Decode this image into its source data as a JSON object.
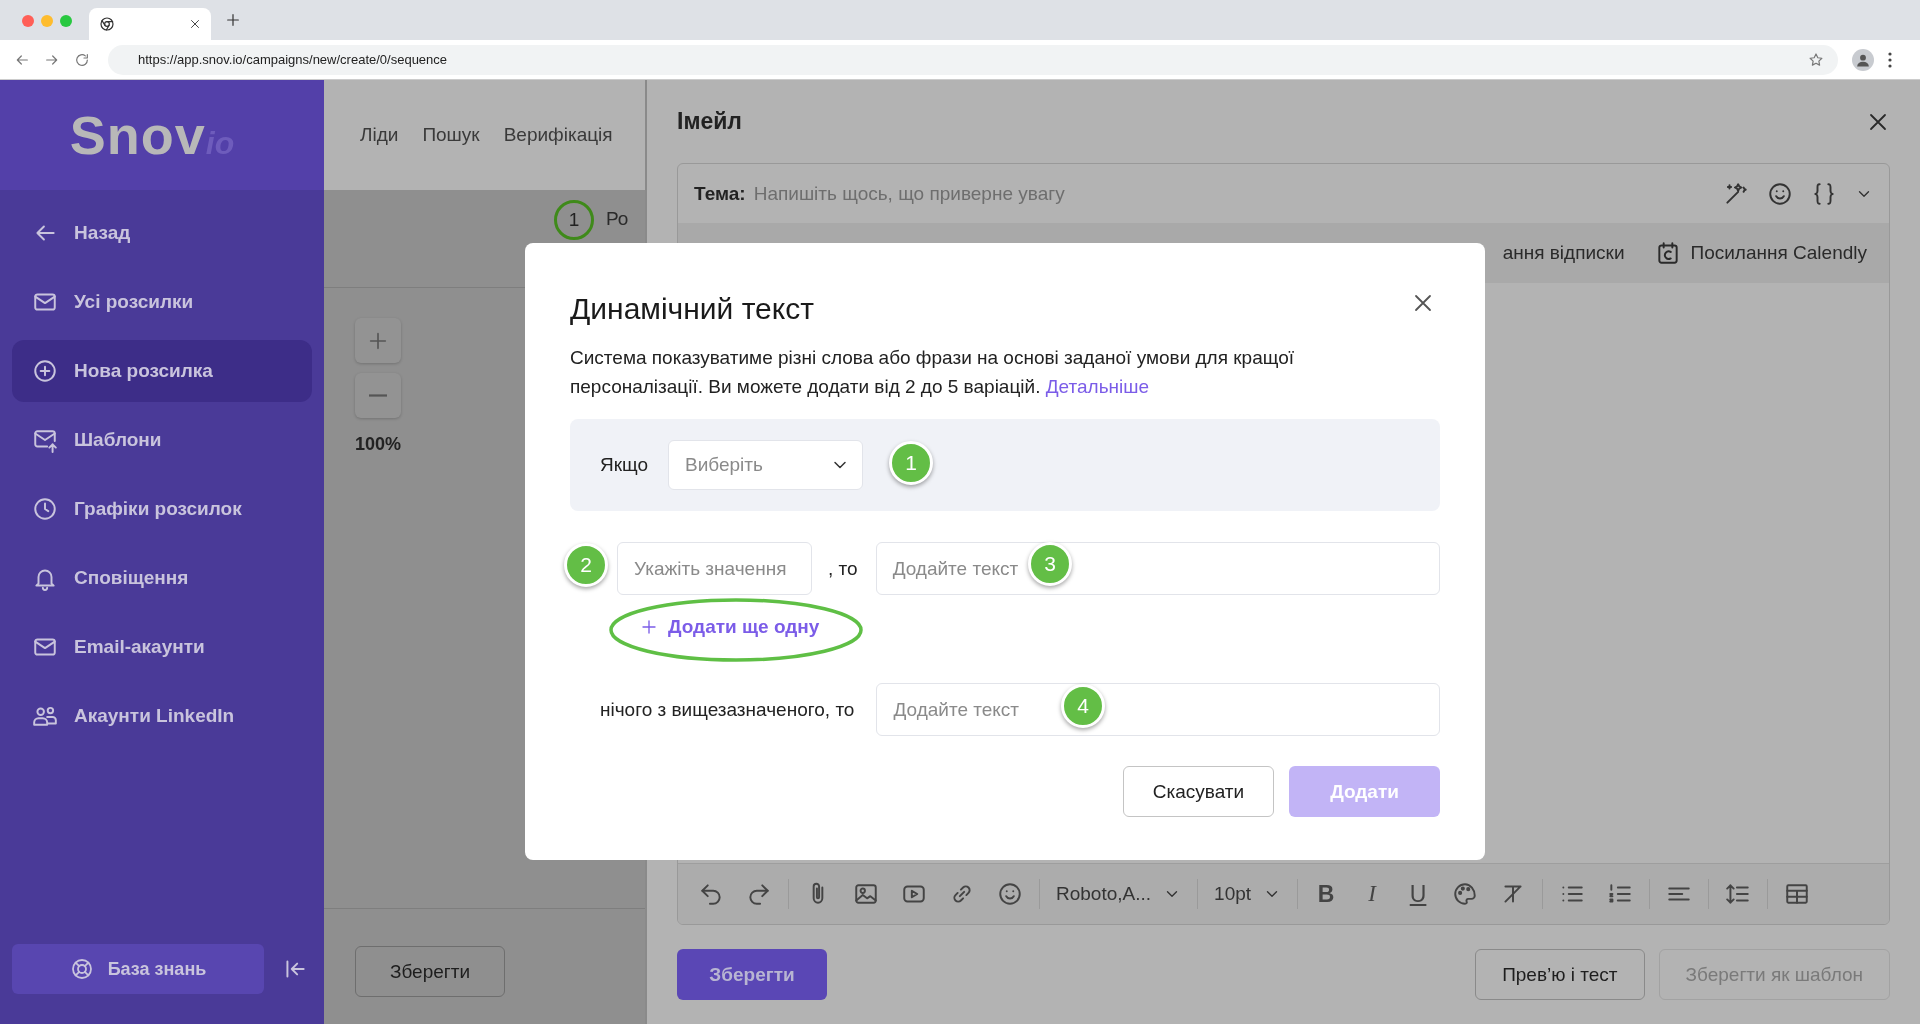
{
  "browser": {
    "url": "https://app.snov.io/campaigns/new/create/0/sequence"
  },
  "sidebar": {
    "logo": {
      "main": "Snov",
      "suffix": "io"
    },
    "items": [
      {
        "label": "Назад",
        "selected": false
      },
      {
        "label": "Усі розсилки",
        "selected": false
      },
      {
        "label": "Нова розсилка",
        "selected": true
      },
      {
        "label": "Шаблони",
        "selected": false
      },
      {
        "label": "Графіки розсилок",
        "selected": false
      },
      {
        "label": "Сповіщення",
        "selected": false
      },
      {
        "label": "Email-акаунти",
        "selected": false
      },
      {
        "label": "Акаунти LinkedIn",
        "selected": false
      }
    ],
    "knowledge_base": "База знань"
  },
  "top_nav": [
    "Ліди",
    "Пошук",
    "Верифікація"
  ],
  "canvas": {
    "step": {
      "number": "1",
      "label": "Ро"
    },
    "zoom_level": "100%",
    "save_button": "Зберегти"
  },
  "email_panel": {
    "title": "Імейл",
    "subject": {
      "label": "Тема:",
      "placeholder": "Напишіть щось, що приверне увагу"
    },
    "insert_bar": [
      "ання відписки",
      "Посилання Calendly"
    ],
    "format_toolbar": {
      "font": "Roboto,A...",
      "size": "10pt",
      "style_buttons": [
        "B",
        "I",
        "U"
      ]
    },
    "buttons": [
      {
        "label": "Зберегти",
        "kind": "primary",
        "disabled": false
      },
      {
        "label": "Прев’ю і тест",
        "kind": "secondary",
        "disabled": false
      },
      {
        "label": "Зберегти як шаблон",
        "kind": "secondary",
        "disabled": true
      }
    ]
  },
  "dialog": {
    "title": "Динамічний текст",
    "description": "Система показуватиме різні слова або фрази на основі заданої умови для кращої персоналізації. Ви можете додати від 2 до 5 варіацій.",
    "link": "Детальніше",
    "condition": {
      "label": "Якщо",
      "select_placeholder": "Виберіть"
    },
    "variant": {
      "value_placeholder": "Укажіть значення",
      "connector": ", то",
      "text_placeholder": "Додайте текст"
    },
    "add_more": "Додати ще одну",
    "fallback": {
      "label": "нічого з вищезазначеного, то",
      "text_placeholder": "Додайте текст"
    },
    "buttons": [
      {
        "label": "Скасувати",
        "kind": "secondary",
        "disabled": false
      },
      {
        "label": "Додати",
        "kind": "primary",
        "disabled": true
      }
    ]
  },
  "annotations": [
    "1",
    "2",
    "3",
    "4"
  ]
}
